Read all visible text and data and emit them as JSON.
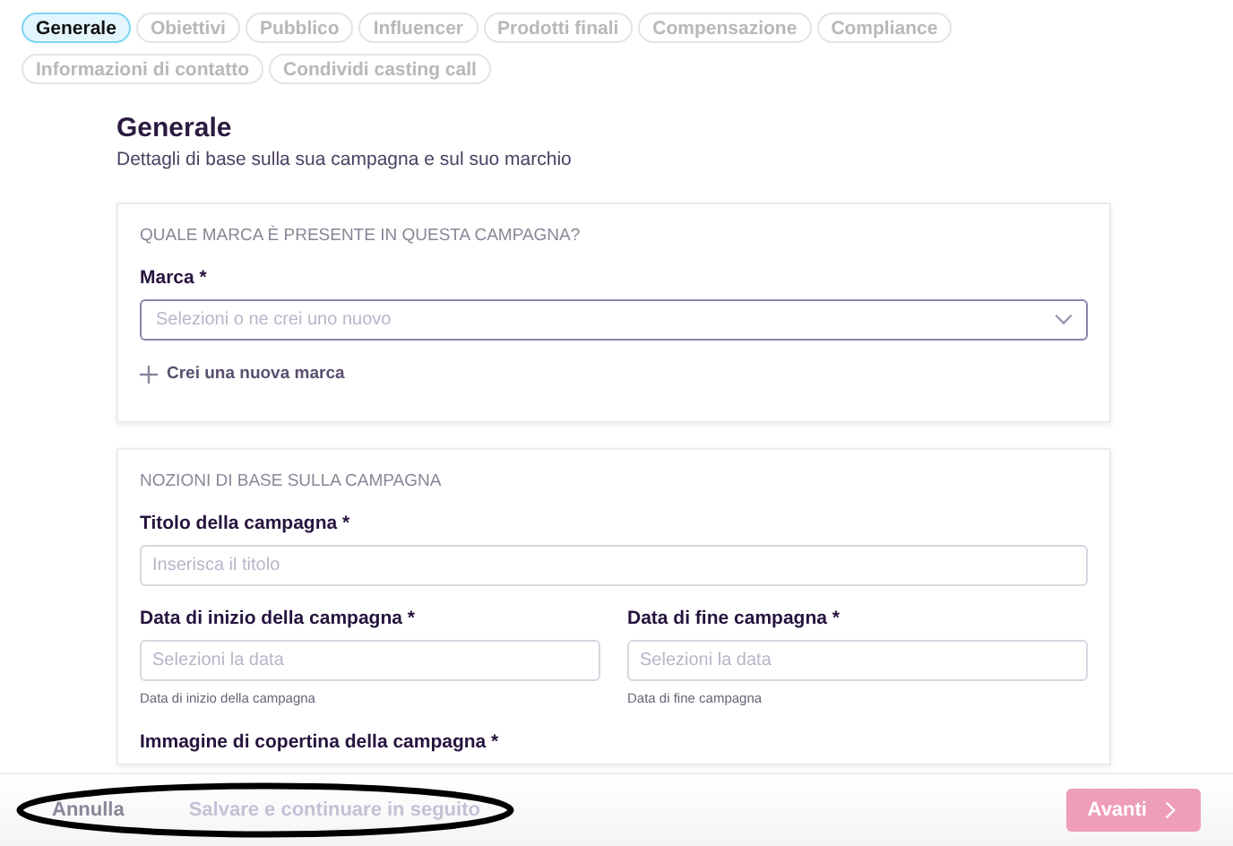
{
  "tabs": [
    {
      "label": "Generale",
      "selected": true
    },
    {
      "label": "Obiettivi",
      "selected": false
    },
    {
      "label": "Pubblico",
      "selected": false
    },
    {
      "label": "Influencer",
      "selected": false
    },
    {
      "label": "Prodotti finali",
      "selected": false
    },
    {
      "label": "Compensazione",
      "selected": false
    },
    {
      "label": "Compliance",
      "selected": false
    },
    {
      "label": "Informazioni di contatto",
      "selected": false
    },
    {
      "label": "Condividi casting call",
      "selected": false
    }
  ],
  "page": {
    "title": "Generale",
    "subtitle": "Dettagli di base sulla sua campagna e sul suo marchio"
  },
  "brand_card": {
    "heading": "QUALE MARCA È PRESENTE IN QUESTA CAMPAGNA?",
    "label": "Marca *",
    "placeholder": "Selezioni o ne crei uno nuovo",
    "add_link": "Crei una nuova marca"
  },
  "basics_card": {
    "heading": "NOZIONI DI BASE SULLA CAMPAGNA",
    "title_label": "Titolo della campagna *",
    "title_placeholder": "Inserisca il titolo",
    "dates": [
      {
        "label": "Data di inizio della campagna *",
        "placeholder": "Selezioni la data",
        "hint": "Data di inizio della campagna"
      },
      {
        "label": "Data di fine campagna *",
        "placeholder": "Selezioni la data",
        "hint": "Data di fine campagna"
      }
    ],
    "cover_label": "Immagine di copertina della campagna *"
  },
  "footer": {
    "cancel": "Annulla",
    "save_later": "Salvare e continuare in seguito",
    "next": "Avanti",
    "next_disabled": true
  }
}
